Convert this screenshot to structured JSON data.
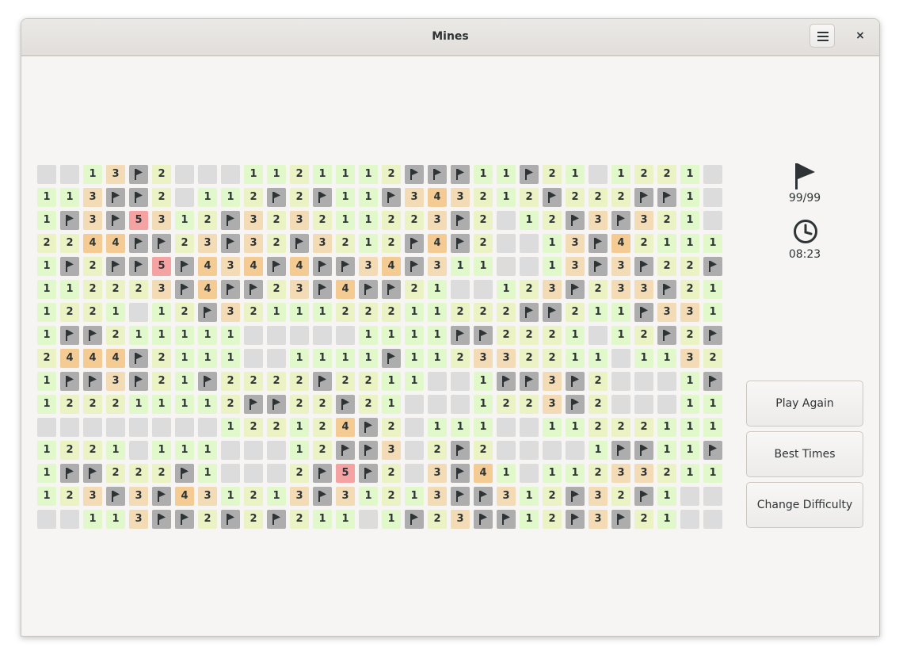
{
  "window": {
    "title": "Mines",
    "menu_icon": "hamburger-menu-icon",
    "close_label": "×"
  },
  "status": {
    "flags": "99/99",
    "flag_icon": "flag-icon",
    "time": "08:23",
    "clock_icon": "clock-icon"
  },
  "buttons": {
    "play_again": "Play Again",
    "best_times": "Best Times",
    "change_difficulty": "Change Difficulty"
  },
  "board": {
    "legend": "u = unrevealed, e = revealed empty, f = flagged, 1-5 = adjacent mine count",
    "rows": [
      [
        "u",
        "u",
        "1",
        "3",
        "f",
        "2",
        "u",
        "u",
        "u",
        "1",
        "1",
        "2",
        "1",
        "1",
        "1",
        "2",
        "f",
        "f",
        "f",
        "1",
        "1",
        "f",
        "2",
        "1",
        "u",
        "1",
        "2",
        "2",
        "1",
        "u"
      ],
      [
        "1",
        "1",
        "3",
        "f",
        "f",
        "2",
        "u",
        "1",
        "1",
        "2",
        "f",
        "2",
        "f",
        "1",
        "1",
        "f",
        "3",
        "4",
        "3",
        "2",
        "1",
        "2",
        "f",
        "2",
        "2",
        "2",
        "f",
        "f",
        "1",
        "u"
      ],
      [
        "1",
        "f",
        "3",
        "f",
        "5",
        "3",
        "1",
        "2",
        "f",
        "3",
        "2",
        "3",
        "2",
        "1",
        "1",
        "2",
        "2",
        "3",
        "f",
        "2",
        "u",
        "1",
        "2",
        "f",
        "3",
        "f",
        "3",
        "2",
        "1",
        "u"
      ],
      [
        "2",
        "2",
        "4",
        "4",
        "f",
        "f",
        "2",
        "3",
        "f",
        "3",
        "2",
        "f",
        "3",
        "2",
        "1",
        "2",
        "f",
        "4",
        "f",
        "2",
        "u",
        "u",
        "1",
        "3",
        "f",
        "4",
        "2",
        "1",
        "1",
        "1"
      ],
      [
        "1",
        "f",
        "2",
        "f",
        "f",
        "5",
        "f",
        "4",
        "3",
        "4",
        "f",
        "4",
        "f",
        "f",
        "3",
        "4",
        "f",
        "3",
        "1",
        "1",
        "u",
        "u",
        "1",
        "3",
        "f",
        "3",
        "f",
        "2",
        "2",
        "f"
      ],
      [
        "1",
        "1",
        "2",
        "2",
        "2",
        "3",
        "f",
        "4",
        "f",
        "f",
        "2",
        "3",
        "f",
        "4",
        "f",
        "f",
        "2",
        "1",
        "u",
        "u",
        "1",
        "2",
        "3",
        "f",
        "2",
        "3",
        "3",
        "f",
        "2",
        "1"
      ],
      [
        "1",
        "2",
        "2",
        "1",
        "u",
        "1",
        "2",
        "f",
        "3",
        "2",
        "1",
        "1",
        "1",
        "2",
        "2",
        "2",
        "1",
        "1",
        "2",
        "2",
        "2",
        "f",
        "f",
        "2",
        "1",
        "1",
        "f",
        "3",
        "3",
        "1"
      ],
      [
        "1",
        "f",
        "f",
        "2",
        "1",
        "1",
        "1",
        "1",
        "1",
        "u",
        "u",
        "u",
        "u",
        "u",
        "1",
        "1",
        "1",
        "1",
        "f",
        "f",
        "2",
        "2",
        "2",
        "1",
        "u",
        "1",
        "2",
        "f",
        "2",
        "f"
      ],
      [
        "2",
        "4",
        "4",
        "4",
        "f",
        "2",
        "1",
        "1",
        "1",
        "u",
        "u",
        "1",
        "1",
        "1",
        "1",
        "f",
        "1",
        "1",
        "2",
        "3",
        "3",
        "2",
        "2",
        "1",
        "1",
        "u",
        "1",
        "1",
        "3",
        "2"
      ],
      [
        "1",
        "f",
        "f",
        "3",
        "f",
        "2",
        "1",
        "f",
        "2",
        "2",
        "2",
        "2",
        "f",
        "2",
        "2",
        "1",
        "1",
        "u",
        "u",
        "1",
        "f",
        "f",
        "3",
        "f",
        "2",
        "u",
        "u",
        "u",
        "1",
        "f"
      ],
      [
        "1",
        "2",
        "2",
        "2",
        "1",
        "1",
        "1",
        "1",
        "2",
        "f",
        "f",
        "2",
        "2",
        "f",
        "2",
        "1",
        "u",
        "u",
        "u",
        "1",
        "2",
        "2",
        "3",
        "f",
        "2",
        "u",
        "u",
        "u",
        "1",
        "1"
      ],
      [
        "u",
        "u",
        "u",
        "u",
        "u",
        "u",
        "u",
        "u",
        "1",
        "2",
        "2",
        "1",
        "2",
        "4",
        "f",
        "2",
        "u",
        "1",
        "1",
        "1",
        "u",
        "u",
        "1",
        "1",
        "2",
        "2",
        "2",
        "1",
        "1",
        "1"
      ],
      [
        "1",
        "2",
        "2",
        "1",
        "u",
        "1",
        "1",
        "1",
        "u",
        "u",
        "u",
        "1",
        "2",
        "f",
        "f",
        "3",
        "u",
        "2",
        "f",
        "2",
        "u",
        "u",
        "u",
        "u",
        "1",
        "f",
        "f",
        "1",
        "1",
        "f"
      ],
      [
        "1",
        "f",
        "f",
        "2",
        "2",
        "2",
        "f",
        "1",
        "u",
        "u",
        "u",
        "2",
        "f",
        "5",
        "f",
        "2",
        "u",
        "3",
        "f",
        "4",
        "1",
        "u",
        "1",
        "1",
        "2",
        "3",
        "3",
        "2",
        "1",
        "1"
      ],
      [
        "1",
        "2",
        "3",
        "f",
        "3",
        "f",
        "4",
        "3",
        "1",
        "2",
        "1",
        "3",
        "f",
        "3",
        "1",
        "2",
        "1",
        "3",
        "f",
        "f",
        "3",
        "1",
        "2",
        "f",
        "3",
        "2",
        "f",
        "1",
        "u",
        "u"
      ],
      [
        "u",
        "u",
        "1",
        "1",
        "3",
        "f",
        "f",
        "2",
        "f",
        "2",
        "f",
        "2",
        "1",
        "1",
        "u",
        "1",
        "f",
        "2",
        "3",
        "f",
        "f",
        "1",
        "2",
        "f",
        "3",
        "f",
        "2",
        "1",
        "u",
        "u"
      ]
    ]
  }
}
